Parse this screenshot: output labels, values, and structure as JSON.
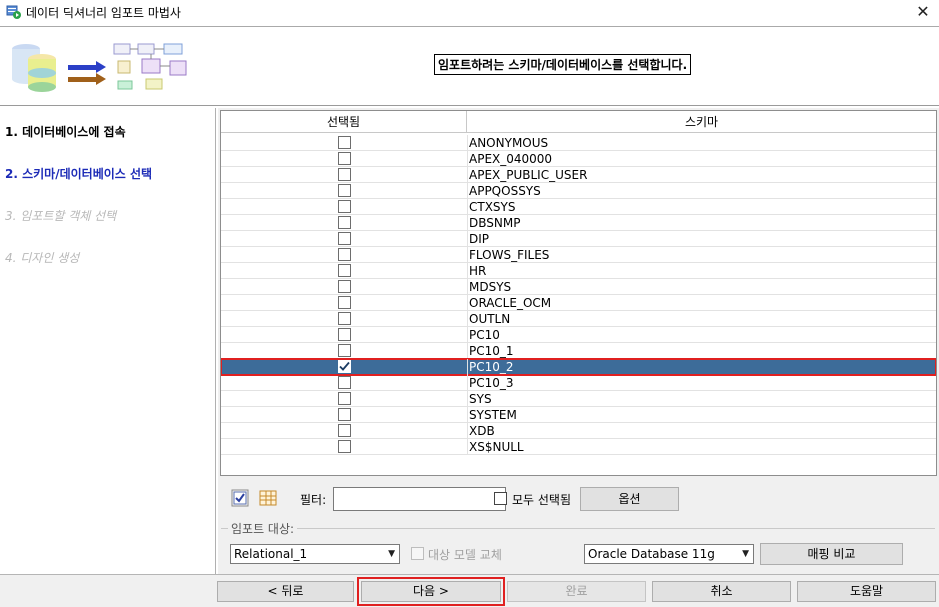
{
  "window": {
    "title": "데이터 딕셔너리 임포트 마법사",
    "close_glyph": "✕"
  },
  "header": {
    "message": "임포트하려는 스키마/데이터베이스를 선택합니다."
  },
  "steps": [
    {
      "label": "1. 데이터베이스에 접속"
    },
    {
      "label": "2. 스키마/데이터베이스 선택"
    },
    {
      "label": "3. 임포트할 객체 선택"
    },
    {
      "label": "4. 디자인 생성"
    }
  ],
  "grid": {
    "col_selected": "선택됨",
    "col_schema": "스키마",
    "rows": [
      {
        "name": "ANONYMOUS",
        "checked": false
      },
      {
        "name": "APEX_040000",
        "checked": false
      },
      {
        "name": "APEX_PUBLIC_USER",
        "checked": false
      },
      {
        "name": "APPQOSSYS",
        "checked": false
      },
      {
        "name": "CTXSYS",
        "checked": false
      },
      {
        "name": "DBSNMP",
        "checked": false
      },
      {
        "name": "DIP",
        "checked": false
      },
      {
        "name": "FLOWS_FILES",
        "checked": false
      },
      {
        "name": "HR",
        "checked": false
      },
      {
        "name": "MDSYS",
        "checked": false
      },
      {
        "name": "ORACLE_OCM",
        "checked": false
      },
      {
        "name": "OUTLN",
        "checked": false
      },
      {
        "name": "PC10",
        "checked": false
      },
      {
        "name": "PC10_1",
        "checked": false
      },
      {
        "name": "PC10_2",
        "checked": true,
        "selected": true
      },
      {
        "name": "PC10_3",
        "checked": false
      },
      {
        "name": "SYS",
        "checked": false
      },
      {
        "name": "SYSTEM",
        "checked": false
      },
      {
        "name": "XDB",
        "checked": false
      },
      {
        "name": "XS$NULL",
        "checked": false
      }
    ]
  },
  "filter": {
    "label": "필터:",
    "value": "",
    "all_selected_label": "모두 선택됨",
    "options_button": "옵션"
  },
  "import_target": {
    "group_label": "임포트 대상:",
    "model": "Relational_1",
    "replace_model_label": "대상 모델 교체",
    "database": "Oracle Database 11g",
    "compare_button": "매핑 비교"
  },
  "footer": {
    "back": "< 뒤로",
    "next": "다음 >",
    "finish": "완료",
    "cancel": "취소",
    "help": "도움말"
  },
  "colors": {
    "selected_row": "#3d6c99",
    "active_step": "#1c2bb7",
    "highlight": "#e02020"
  }
}
